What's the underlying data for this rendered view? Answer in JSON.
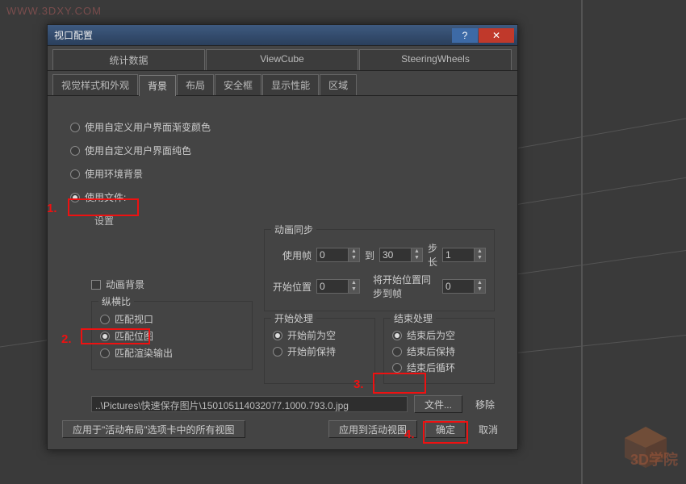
{
  "watermark": "WWW.3DXY.COM",
  "watermark2": "3D学院",
  "dialog": {
    "title": "视口配置",
    "tabs_row1": [
      "统计数据",
      "ViewCube",
      "SteeringWheels"
    ],
    "tabs_row2": [
      "视觉样式和外观",
      "背景",
      "布局",
      "安全框",
      "显示性能",
      "区域"
    ],
    "radios": {
      "r1": "使用自定义用户界面渐变颜色",
      "r2": "使用自定义用户界面纯色",
      "r3": "使用环境背景",
      "r4": "使用文件:"
    },
    "settings_label": "设置",
    "anim_bg": "动画背景",
    "aspect": {
      "legend": "纵横比",
      "o1": "匹配视口",
      "o2": "匹配位图",
      "o3": "匹配渲染输出"
    },
    "anim": {
      "legend": "动画同步",
      "use_frame": "使用帧",
      "use_v": "0",
      "to": "到",
      "to_v": "30",
      "step": "步长",
      "step_v": "1",
      "start": "开始位置",
      "start_v": "0",
      "sync": "将开始位置同步到帧",
      "sync_v": "0"
    },
    "startproc": {
      "legend": "开始处理",
      "o1": "开始前为空",
      "o2": "开始前保持"
    },
    "endproc": {
      "legend": "结束处理",
      "o1": "结束后为空",
      "o2": "结束后保持",
      "o3": "结束后循环"
    },
    "path": "..\\Pictures\\快速保存图片\\1501051140320​77.1000.793.0.jpg",
    "file_btn": "文件...",
    "remove": "移除",
    "apply_all": "应用于\"活动布局\"选项卡中的所有视图",
    "apply_active": "应用到活动视图",
    "ok": "确定",
    "cancel": "取消"
  },
  "anno": {
    "n1": "1.",
    "n2": "2.",
    "n3": "3.",
    "n4": "4."
  }
}
